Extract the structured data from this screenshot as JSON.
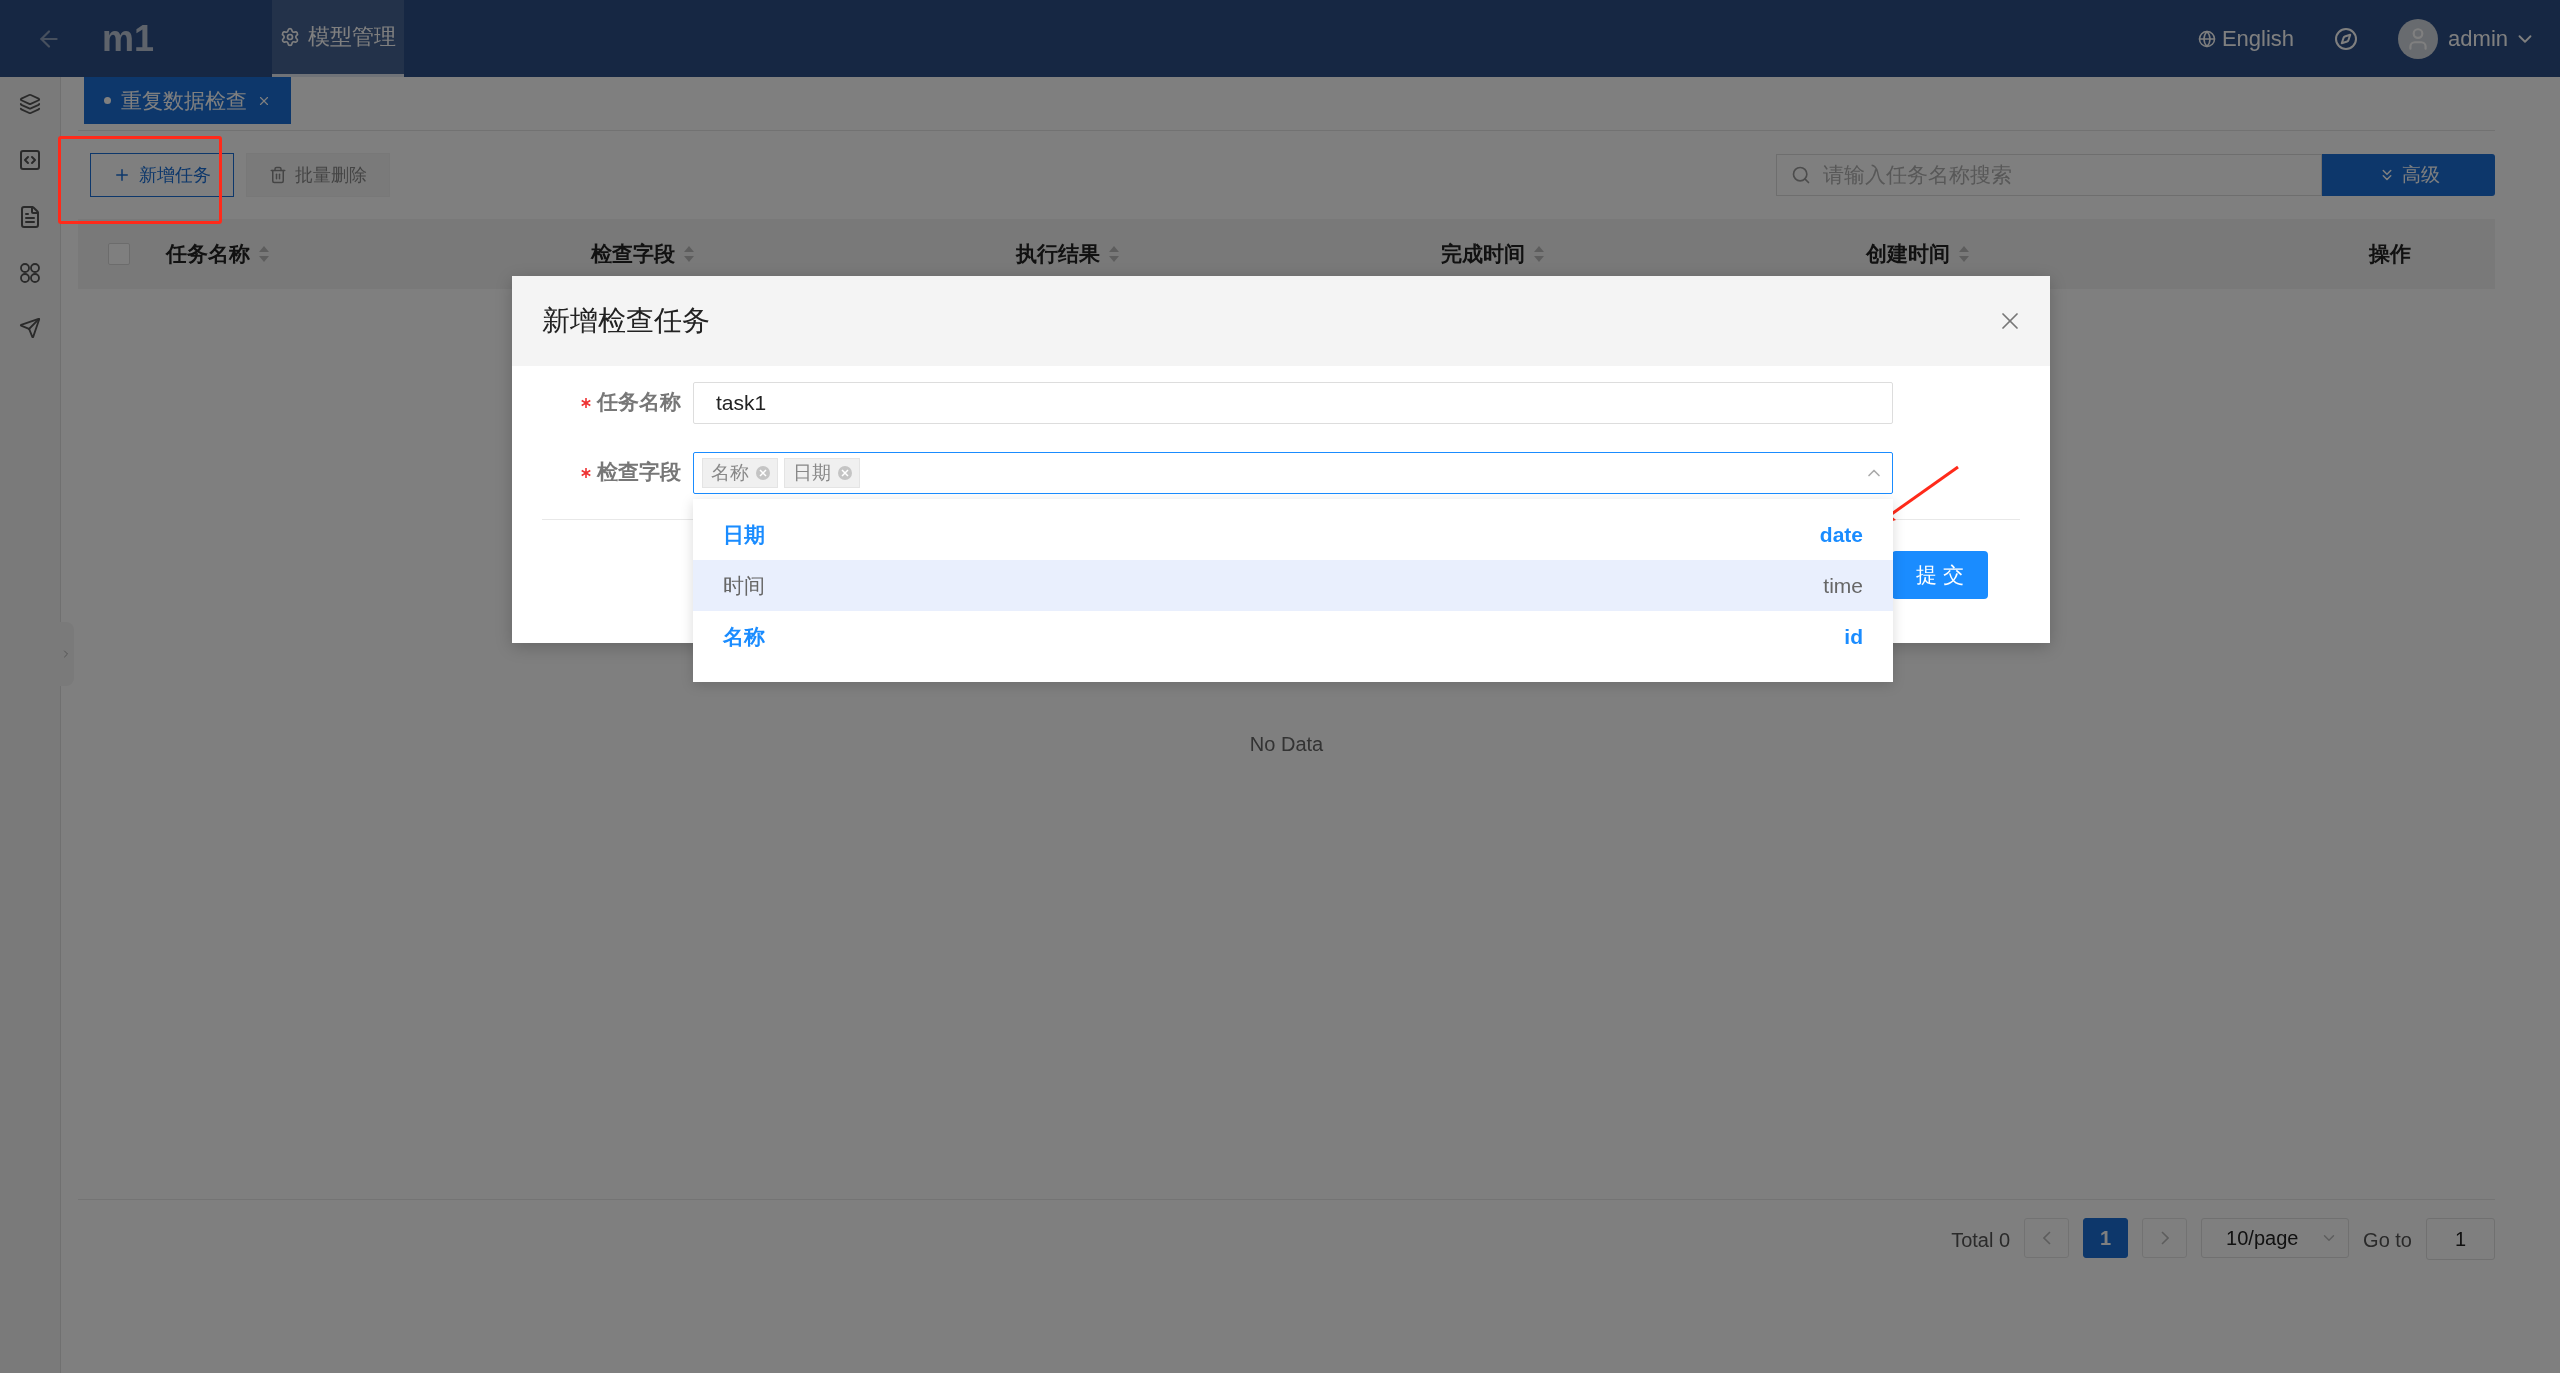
{
  "header": {
    "title": "m1",
    "nav": [
      {
        "label": "模型管理",
        "selected": true
      }
    ],
    "language": "English",
    "user": "admin"
  },
  "tabs": [
    {
      "label": "重复数据检查",
      "selected": true
    }
  ],
  "toolbar": {
    "buttons": [
      {
        "label": "新增任务",
        "disabled": false,
        "kind": "add"
      },
      {
        "label": "批量删除",
        "disabled": true,
        "kind": "delete"
      }
    ],
    "search": {
      "placeholder": "请输入任务名称搜索"
    },
    "advanced": "高级"
  },
  "table": {
    "select_all": {
      "checked": false
    },
    "columns": [
      {
        "label": "任务名称",
        "sortable": true
      },
      {
        "label": "检查字段",
        "sortable": true
      },
      {
        "label": "执行结果",
        "sortable": true
      },
      {
        "label": "完成时间",
        "sortable": true
      },
      {
        "label": "创建时间",
        "sortable": true
      },
      {
        "label": "操作",
        "sortable": false
      }
    ],
    "empty": "No Data"
  },
  "pagination": {
    "total": "Total 0",
    "pages": [
      {
        "label": "1",
        "selected": true
      }
    ],
    "page_size": "10/page",
    "goto_label": "Go to",
    "goto_value": "1"
  },
  "dialog": {
    "title": "新增检查任务",
    "fields": [
      {
        "label": "任务名称",
        "required": true,
        "kind": "input",
        "value": "task1"
      },
      {
        "label": "检查字段",
        "required": true,
        "kind": "select",
        "expanded": true,
        "tags": [
          "名称",
          "日期"
        ]
      }
    ],
    "options": [
      {
        "label": "日期",
        "code": "date",
        "selected": true,
        "hovered": false
      },
      {
        "label": "时间",
        "code": "time",
        "selected": false,
        "hovered": true
      },
      {
        "label": "名称",
        "code": "id",
        "selected": true,
        "hovered": false
      }
    ],
    "submit": "提 交"
  }
}
